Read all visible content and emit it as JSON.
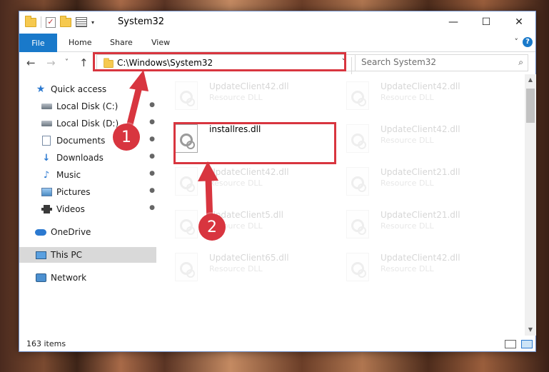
{
  "window": {
    "title": "System32",
    "controls": {
      "minimize": "—",
      "maximize": "☐",
      "close": "✕"
    }
  },
  "ribbon": {
    "tabs": [
      "File",
      "Home",
      "Share",
      "View"
    ],
    "help": "?",
    "chevron": "˅"
  },
  "navigation": {
    "back": "←",
    "forward": "→",
    "recent": "˅",
    "up": "↑",
    "address": "C:\\Windows\\System32",
    "address_dropdown": "˅",
    "refresh": "↻",
    "search_placeholder": "Search System32",
    "search_icon": "⌕"
  },
  "sidebar": {
    "items": [
      {
        "label": "Quick access",
        "icon": "star-icon",
        "pinned": false
      },
      {
        "label": "Local Disk (C:)",
        "icon": "drive-icon",
        "pinned": true
      },
      {
        "label": "Local Disk (D:)",
        "icon": "drive-icon",
        "pinned": true
      },
      {
        "label": "Documents",
        "icon": "documents-icon",
        "pinned": true
      },
      {
        "label": "Downloads",
        "icon": "downloads-icon",
        "pinned": true
      },
      {
        "label": "Music",
        "icon": "music-icon",
        "pinned": true
      },
      {
        "label": "Pictures",
        "icon": "pictures-icon",
        "pinned": true
      },
      {
        "label": "Videos",
        "icon": "videos-icon",
        "pinned": true
      },
      {
        "label": "OneDrive",
        "icon": "onedrive-icon",
        "pinned": false
      },
      {
        "label": "This PC",
        "icon": "this-pc-icon",
        "pinned": false,
        "selected": true
      },
      {
        "label": "Network",
        "icon": "network-icon",
        "pinned": false
      }
    ],
    "pin_glyph": "📌"
  },
  "files": [
    {
      "name": "UpdateClient42.dll",
      "type": "Resource DLL",
      "faded": true
    },
    {
      "name": "UpdateClient42.dll",
      "type": "Resource DLL",
      "faded": true
    },
    {
      "name": "installres.dll",
      "type": "",
      "faded": false,
      "highlighted": true
    },
    {
      "name": "UpdateClient42.dll",
      "type": "Resource DLL",
      "faded": true
    },
    {
      "name": "UpdateClient42.dll",
      "type": "Resource DLL",
      "faded": true
    },
    {
      "name": "UpdateClient21.dll",
      "type": "Resource DLL",
      "faded": true
    },
    {
      "name": "UpdateClient5.dll",
      "type": "Resource DLL",
      "faded": true
    },
    {
      "name": "UpdateClient21.dll",
      "type": "Resource DLL",
      "faded": true
    },
    {
      "name": "UpdateClient65.dll",
      "type": "Resource DLL",
      "faded": true
    },
    {
      "name": "UpdateClient42.dll",
      "type": "Resource DLL",
      "faded": true
    }
  ],
  "status": {
    "item_count": "163 items"
  },
  "annotations": {
    "step1": "1",
    "step2": "2",
    "color": "#d8353f"
  }
}
